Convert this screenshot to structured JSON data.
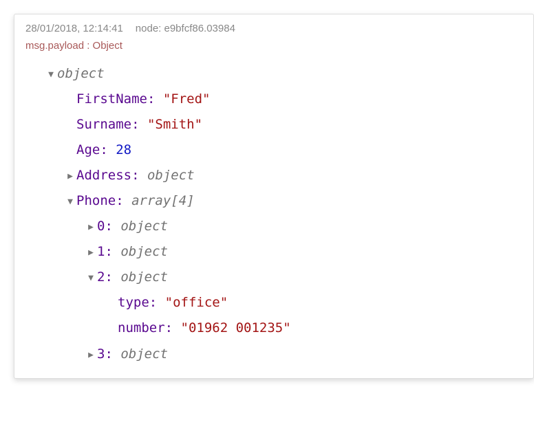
{
  "header": {
    "timestamp": "28/01/2018, 12:14:41",
    "node_label": "node: e9bfcf86.03984"
  },
  "topic": "msg.payload : Object",
  "tree": {
    "root_type": "object",
    "firstName": {
      "key": "FirstName",
      "value": "\"Fred\""
    },
    "surname": {
      "key": "Surname",
      "value": "\"Smith\""
    },
    "age": {
      "key": "Age",
      "value": "28"
    },
    "address": {
      "key": "Address",
      "type": "object"
    },
    "phone": {
      "key": "Phone",
      "type": "array[4]"
    },
    "phone0": {
      "key": "0",
      "type": "object"
    },
    "phone1": {
      "key": "1",
      "type": "object"
    },
    "phone2": {
      "key": "2",
      "type": "object"
    },
    "phone2_type": {
      "key": "type",
      "value": "\"office\""
    },
    "phone2_number": {
      "key": "number",
      "value": "\"01962 001235\""
    },
    "phone3": {
      "key": "3",
      "type": "object"
    }
  }
}
